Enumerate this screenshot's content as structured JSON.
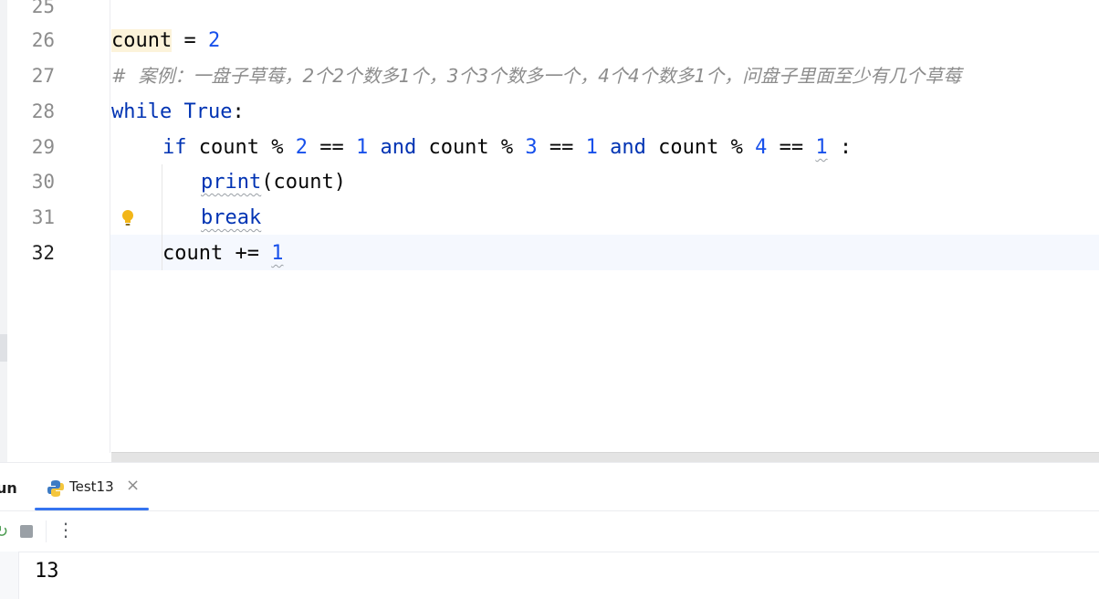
{
  "editor": {
    "line_numbers": [
      "25",
      "26",
      "27",
      "28",
      "29",
      "30",
      "31",
      "32"
    ],
    "current_line": "32",
    "lines": {
      "l26": {
        "var": "count",
        "op": " = ",
        "num": "2"
      },
      "l27": {
        "comment": "#  案例：一盘子草莓，2个2个数多1个，3个3个数多一个，4个4个数多1个，问盘子里面至少有几个草莓"
      },
      "l28": {
        "kw_while": "while",
        "sp": " ",
        "kw_true": "True",
        "colon": ":"
      },
      "l29": {
        "kw_if": "if",
        "p1": " count % ",
        "n1": "2",
        "p2": " == ",
        "n2": "1",
        "sp1": " ",
        "and1": "and",
        "p3": " count % ",
        "n3": "3",
        "p4": " == ",
        "n4": "1",
        "sp2": " ",
        "and2": "and",
        "p5": " count % ",
        "n5": "4",
        "p6": " == ",
        "n6": "1",
        "p7": " :"
      },
      "l30": {
        "fn": "print",
        "args": "(count)"
      },
      "l31": {
        "kw_break": "break"
      },
      "l32": {
        "text": "count += ",
        "num": "1"
      }
    }
  },
  "run_panel": {
    "title": "un",
    "tab_label": "Test13",
    "tab_close": "×",
    "rerun_icon": "↻",
    "more_icon": "⋮",
    "output": "13"
  },
  "colors": {
    "keyword": "#0033b3",
    "number": "#1750eb",
    "comment": "#8c8c8c",
    "accent": "#3574f0"
  }
}
